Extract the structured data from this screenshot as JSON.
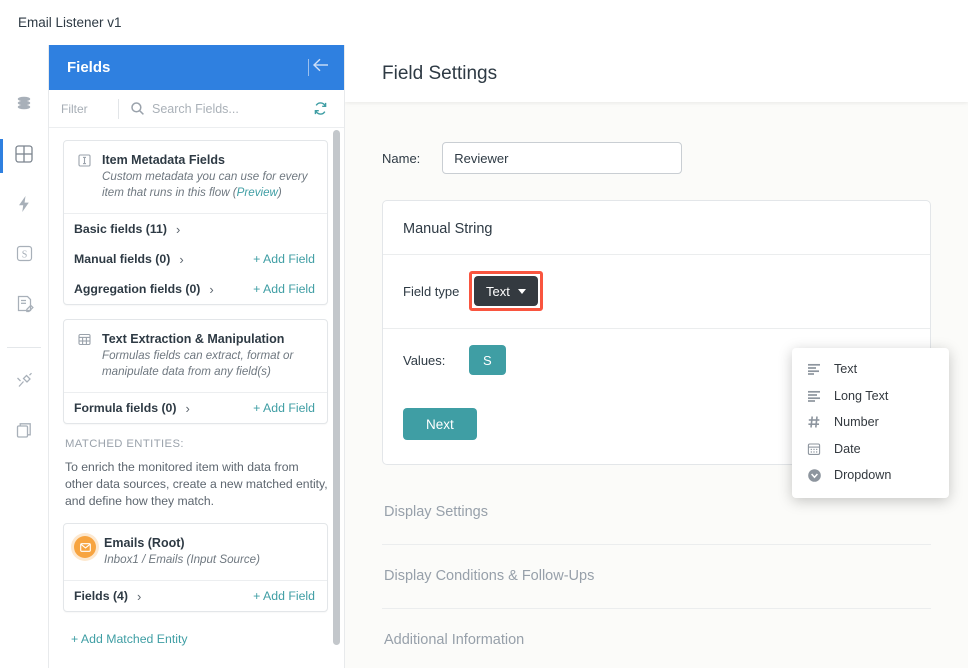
{
  "topbar": {
    "title": "Email Listener v1"
  },
  "rail": {
    "items": [
      {
        "icon": "database-icon",
        "name": "rail-item-data-sources",
        "active": false
      },
      {
        "icon": "grid-icon",
        "name": "rail-item-fields",
        "active": true
      },
      {
        "icon": "lightning-icon",
        "name": "rail-item-actions",
        "active": false
      },
      {
        "icon": "script-s-icon",
        "name": "rail-item-scripts",
        "active": false
      },
      {
        "icon": "document-edit-icon",
        "name": "rail-item-forms",
        "active": false
      },
      {
        "icon": "plug-icon",
        "name": "rail-item-integrations",
        "active": false
      },
      {
        "icon": "layers-icon",
        "name": "rail-item-versions",
        "active": false
      }
    ]
  },
  "fields_panel": {
    "header_title": "Fields",
    "collapse_icon": "arrow-left-collapse-icon",
    "filter_label": "Filter",
    "search": {
      "placeholder": "Search Fields...",
      "value": "",
      "icon": "search-icon",
      "refresh_icon": "refresh-icon"
    },
    "cards": [
      {
        "icon": "text-cursor-icon",
        "title": "Item Metadata Fields",
        "subtitle_before": "Custom metadata you can use for every item that runs in this flow (",
        "subtitle_link": "Preview",
        "subtitle_after": ")",
        "rows": [
          {
            "label": "Basic fields (11)",
            "chevron": "›",
            "action": ""
          },
          {
            "label": "Manual fields (0)",
            "chevron": "›",
            "action": "+ Add Field"
          },
          {
            "label": "Aggregation fields (0)",
            "chevron": "›",
            "action": "+ Add Field"
          }
        ]
      },
      {
        "icon": "grid-small-icon",
        "title": "Text Extraction & Manipulation",
        "subtitle_before": "Formulas fields can extract, format or manipulate data from any field(s)",
        "subtitle_link": "",
        "subtitle_after": "",
        "rows": [
          {
            "label": "Formula fields (0)",
            "chevron": "›",
            "action": "+ Add Field"
          }
        ]
      }
    ],
    "matched_entities": {
      "heading": "MATCHED ENTITIES:",
      "description": "To enrich the monitored item with data from other data sources, create a new matched entity, and define how they match.",
      "entity": {
        "icon": "envelope-circle-icon",
        "title": "Emails (Root)",
        "subtitle": "Inbox1 / Emails (Input Source)",
        "row": {
          "label": "Fields (4)",
          "chevron": "›",
          "action": "+ Add Field"
        }
      },
      "add_entity_label": "+ Add Matched Entity"
    }
  },
  "main": {
    "header_title": "Field Settings",
    "name_label": "Name:",
    "name_value": "Reviewer",
    "name_placeholder": "",
    "settings_card": {
      "title": "Manual String",
      "field_type_label": "Field type",
      "field_type_value": "Text",
      "field_type_caret": "caret-down-icon",
      "values_label": "Values:",
      "values_button_label": "S",
      "next_label": "Next"
    },
    "dropdown": {
      "items": [
        {
          "label": "Text",
          "icon": "text-lines-icon"
        },
        {
          "label": "Long Text",
          "icon": "long-text-lines-icon"
        },
        {
          "label": "Number",
          "icon": "hash-icon"
        },
        {
          "label": "Date",
          "icon": "calendar-icon"
        },
        {
          "label": "Dropdown",
          "icon": "dropdown-circle-icon"
        }
      ]
    },
    "sections": [
      {
        "label": "Display Settings"
      },
      {
        "label": "Display Conditions & Follow-Ups"
      },
      {
        "label": "Additional Information"
      }
    ]
  },
  "colors": {
    "brand_blue": "#2f80e0",
    "teal": "#3f9ea4",
    "highlight_red": "#f9553f",
    "dark_button": "#343a40",
    "orange": "#f7a440"
  }
}
